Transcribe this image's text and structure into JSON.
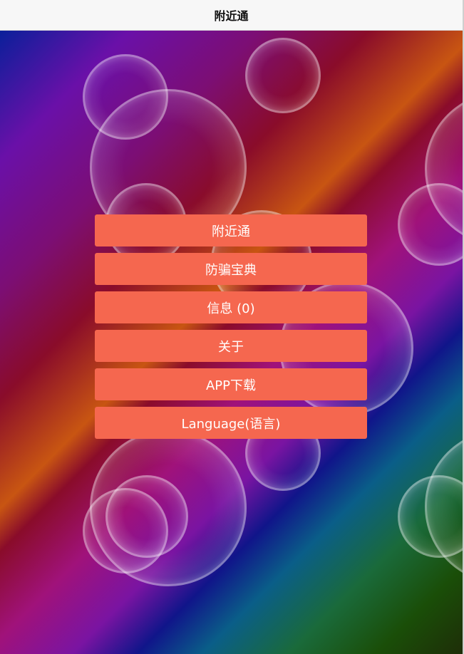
{
  "header": {
    "title": "附近通"
  },
  "menu": {
    "items": [
      {
        "label": "附近通"
      },
      {
        "label": "防骗宝典"
      },
      {
        "label": "信息 (0)"
      },
      {
        "label": "关于"
      },
      {
        "label": "APP下载"
      },
      {
        "label": "Language(语言)"
      }
    ]
  },
  "colors": {
    "button_bg": "#f5674f",
    "button_text": "#ffffff",
    "header_bg": "#f7f7f7"
  }
}
